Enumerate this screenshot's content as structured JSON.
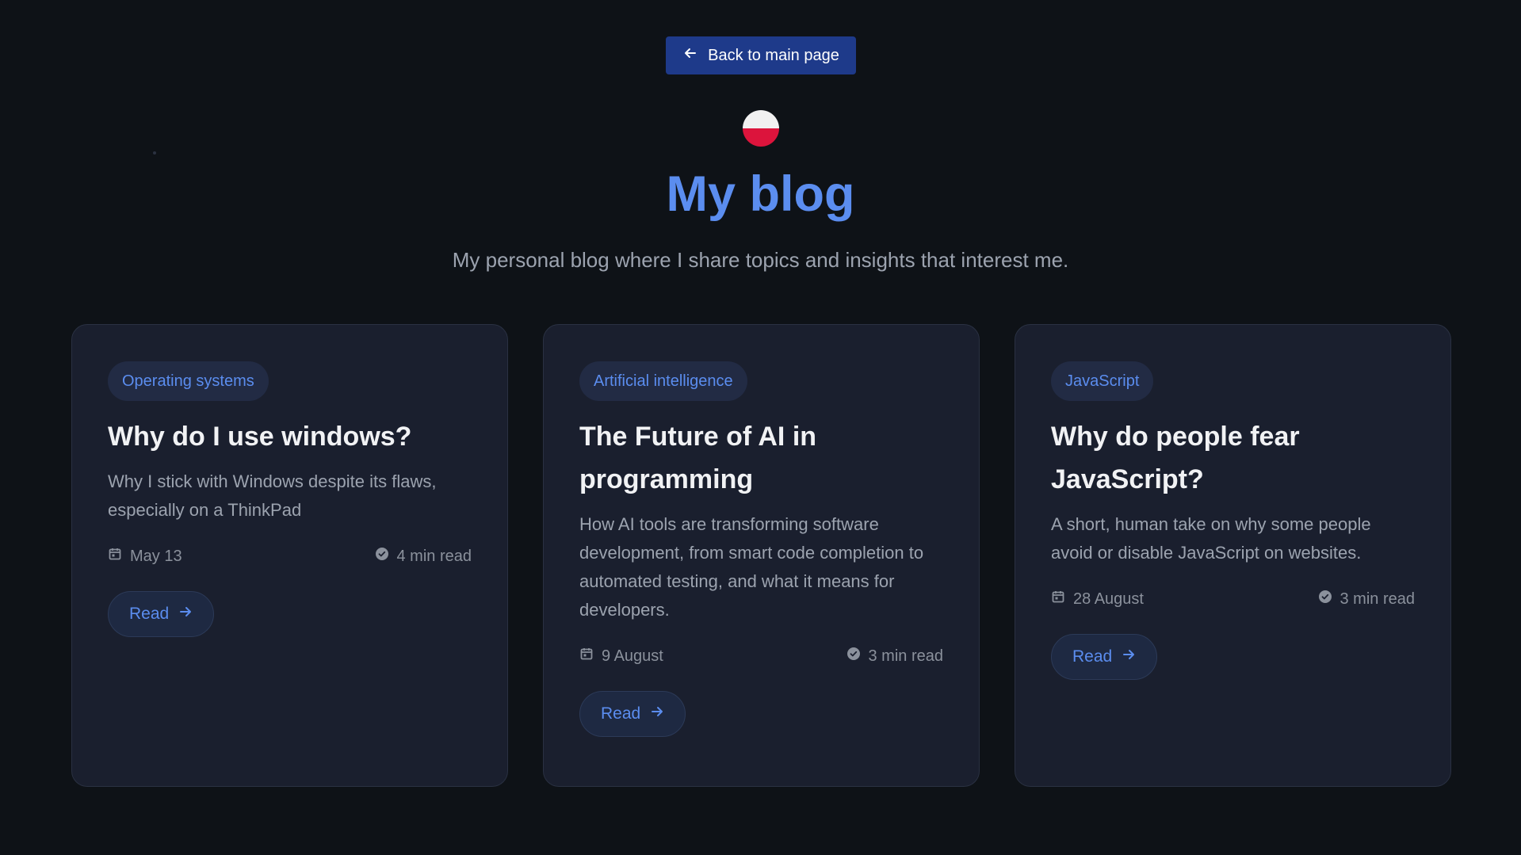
{
  "header": {
    "back_label": "Back to main page",
    "title": "My blog",
    "subtitle": "My personal blog where I share topics and insights that interest me."
  },
  "language_flag": {
    "colors": [
      "#f1f1f1",
      "#dc143c"
    ]
  },
  "posts": [
    {
      "tag": "Operating systems",
      "title": "Why do I use windows?",
      "description": "Why I stick with Windows despite its flaws, especially on a ThinkPad",
      "date": "May 13",
      "read_time": "4 min read",
      "read_label": "Read"
    },
    {
      "tag": "Artificial intelligence",
      "title": "The Future of AI in programming",
      "description": "How AI tools are transforming software development, from smart code completion to automated testing, and what it means for developers.",
      "date": "9 August",
      "read_time": "3 min read",
      "read_label": "Read"
    },
    {
      "tag": "JavaScript",
      "title": "Why do people fear JavaScript?",
      "description": "A short, human take on why some people avoid or disable JavaScript on websites.",
      "date": "28 August",
      "read_time": "3 min read",
      "read_label": "Read"
    }
  ],
  "colors": {
    "background": "#0e1217",
    "accent": "#5b8def",
    "card": "#1a1f2e",
    "back_button": "#1e3a8a"
  }
}
